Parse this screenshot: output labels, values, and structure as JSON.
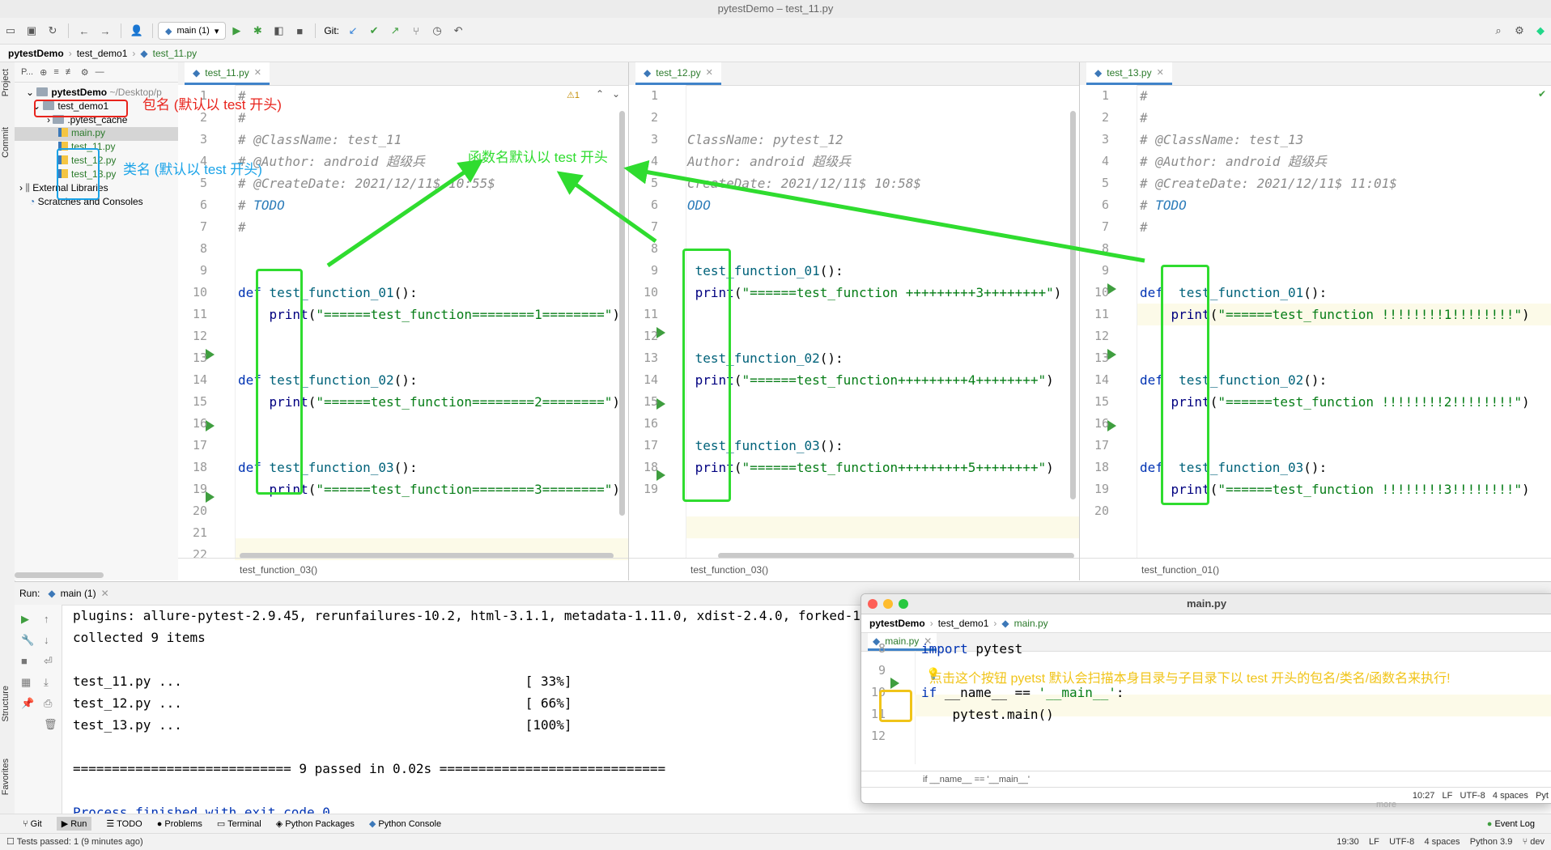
{
  "window": {
    "title": "pytestDemo – test_11.py"
  },
  "toolbar": {
    "run_config": "main (1)",
    "git_label": "Git:"
  },
  "breadcrumb": {
    "project": "pytestDemo",
    "folder": "test_demo1",
    "file": "test_11.py"
  },
  "left_stripe": {
    "project": "Project",
    "commit": "Commit",
    "structure": "Structure",
    "favorites": "Favorites"
  },
  "project_panel": {
    "header": "P...",
    "root": "pytestDemo",
    "root_path": "~/Desktop/p",
    "items": {
      "test_demo1": "test_demo1",
      "pytest_cache": ".pytest_cache",
      "main": "main.py",
      "t11": "test_11.py",
      "t12": "test_12.py",
      "t13": "test_13.py",
      "extlib": "External Libraries",
      "scratches": "Scratches and Consoles"
    }
  },
  "pane1": {
    "tab": "test_11.py",
    "warn": "⚠1",
    "status": "test_function_03()",
    "lines": {
      "1": "#",
      "2": "#",
      "3": "# @ClassName: test_11",
      "4": "# @Author: android 超级兵",
      "5": "# @CreateDate: 2021/12/11$ 10:55$",
      "6a": "# ",
      "6b": "TODO",
      "7": "#",
      "10a": "def",
      "10b": "test_function_01",
      "10c": "():",
      "11a": "print",
      "11b": "(",
      "11c": "\"======test_function========1========\"",
      "11d": ")",
      "14a": "def",
      "14b": "test_function_02",
      "14c": "():",
      "15a": "print",
      "15b": "(",
      "15c": "\"======test_function========2========\"",
      "15d": ")",
      "18a": "def",
      "18b": "test_function_03",
      "18c": "():",
      "19a": "print",
      "19b": "(",
      "19c": "\"======test_function========3========\"",
      "19d": ")"
    }
  },
  "pane2": {
    "tab": "test_12.py",
    "status": "test_function_03()",
    "lines": {
      "3": "ClassName: pytest_12",
      "4": "Author: android 超级兵",
      "5": "CreateDate: 2021/12/11$ 10:58$",
      "6": "ODO",
      "9": "test_function_01",
      "9c": "():",
      "10a": "print",
      "10b": "(",
      "10c": "\"======test_function +++++++++3++++++++\"",
      "10d": ")",
      "13": "test_function_02",
      "13c": "():",
      "14a": "print",
      "14b": "(",
      "14c": "\"======test_function+++++++++4++++++++\"",
      "14d": ")",
      "17": "test_function_03",
      "17c": "():",
      "18a": "print",
      "18b": "(",
      "18c": "\"======test_function+++++++++5++++++++\"",
      "18d": ")"
    }
  },
  "pane3": {
    "tab": "test_13.py",
    "status": "test_function_01()",
    "lines": {
      "1": "#",
      "2": "#",
      "3": "# @ClassName: test_13",
      "4": "# @Author: android 超级兵",
      "5": "# @CreateDate: 2021/12/11$ 11:01$",
      "6a": "# ",
      "6b": "TODO",
      "7": "#",
      "10a": "def",
      "10b": "test_function_01",
      "10c": "():",
      "11a": "print",
      "11b": "(",
      "11c": "\"======test_function !!!!!!!!1!!!!!!!!\"",
      "11d": ")",
      "14a": "def",
      "14b": "test_function_02",
      "14c": "():",
      "15a": "print",
      "15b": "(",
      "15c": "\"======test_function !!!!!!!!2!!!!!!!!\"",
      "15d": ")",
      "18a": "def",
      "18b": "test_function_03",
      "18c": "():",
      "19a": "print",
      "19b": "(",
      "19c": "\"======test_function !!!!!!!!3!!!!!!!!\"",
      "19d": ")"
    }
  },
  "run_window": {
    "label": "Run:",
    "tab": "main (1)",
    "console": {
      "l1": "plugins: allure-pytest-2.9.45, rerunfailures-10.2, html-3.1.1, metadata-1.11.0, xdist-2.4.0, forked-1",
      "l2": "collected 9 items",
      "l4a": "test_11.py ...",
      "l4b": "[ 33%]",
      "l5a": "test_12.py ...",
      "l5b": "[ 66%]",
      "l6a": "test_13.py ...",
      "l6b": "[100%]",
      "l8": "============================ 9 passed in 0.02s =============================",
      "l10": "Process finished with exit code 0"
    }
  },
  "bottom_tabs": {
    "git": "Git",
    "run": "Run",
    "todo": "TODO",
    "problems": "Problems",
    "terminal": "Terminal",
    "packages": "Python Packages",
    "console": "Python Console",
    "eventlog": "Event Log"
  },
  "status_bar": {
    "left": "Tests passed: 1 (9 minutes ago)",
    "pos": "19:30",
    "lf": "LF",
    "enc": "UTF-8",
    "indent": "4 spaces",
    "python": "Python 3.9",
    "branch": "dev"
  },
  "float_window": {
    "title": "main.py",
    "crumb_project": "pytestDemo",
    "crumb_folder": "test_demo1",
    "crumb_file": "main.py",
    "tab": "main.py",
    "l8a": "import",
    "l8b": " pytest",
    "l10a": "if",
    "l10b": " __name__ == ",
    "l10c": "'__main__'",
    "l10d": ":",
    "l11": "    pytest.main()",
    "status": "if __name__ == '__main__'",
    "pos": "10:27",
    "lf": "LF",
    "enc": "UTF-8",
    "indent": "4 spaces",
    "python": "Pyt",
    "more": "more"
  },
  "annotations": {
    "package": "包名 (默认以 test 开头)",
    "class": "类名 (默认以 test 开头)",
    "function": "函数名默认以 test 开头",
    "button": "点击这个按钮 pyetst 默认会扫描本身目录与子目录下以 test 开头的包名/类名/函数名来执行!"
  },
  "colors": {
    "annotation_red": "#e8241d",
    "annotation_cyan": "#1aa3e8",
    "annotation_green": "#2fdc2f",
    "annotation_yellow": "#f0c419"
  }
}
